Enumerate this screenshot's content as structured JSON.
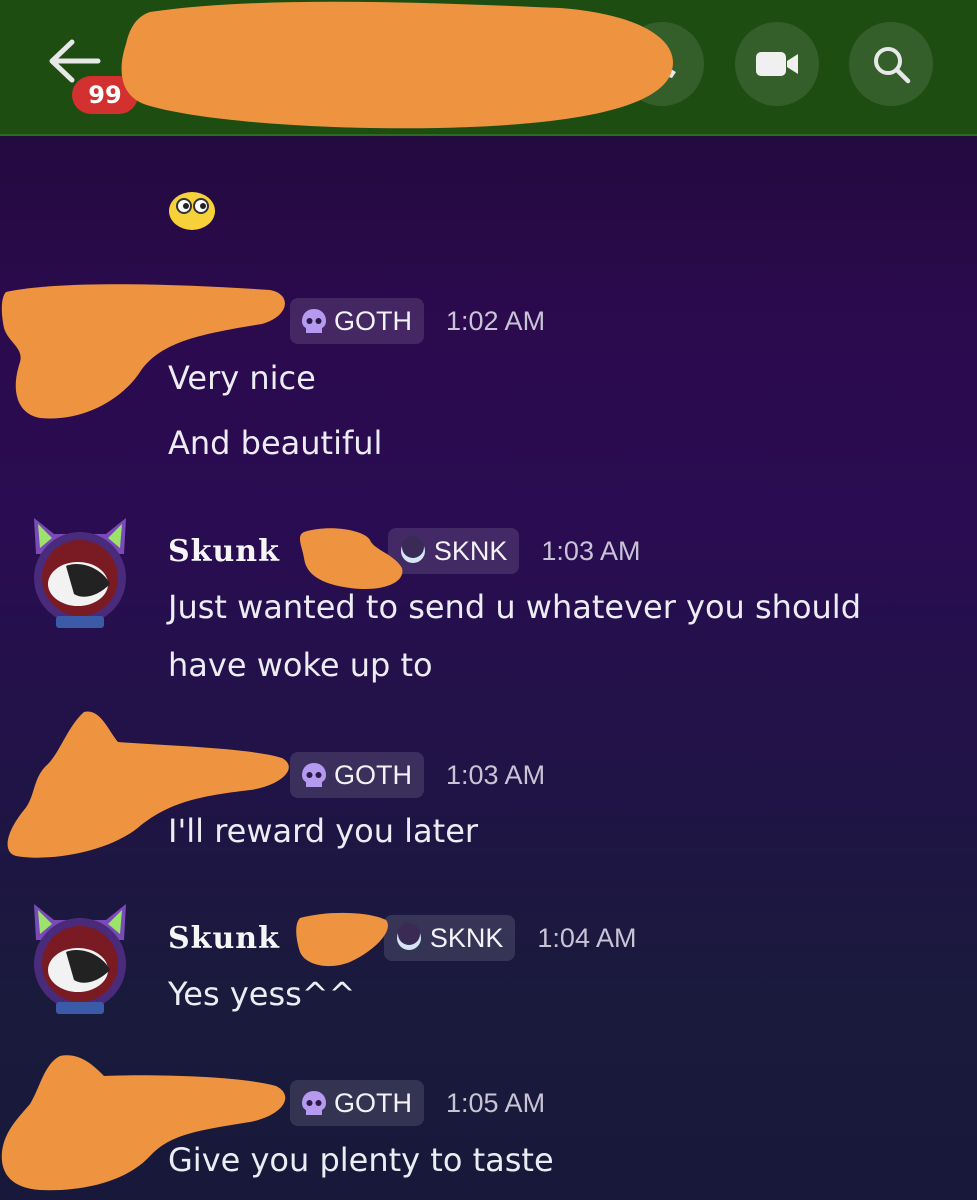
{
  "header": {
    "unread_badge": "99",
    "icons": [
      "back-arrow-icon",
      "call-icon",
      "video-icon",
      "search-icon"
    ]
  },
  "emoji_message": {
    "icon": "eyes-emoji"
  },
  "messages": [
    {
      "author": "",
      "tag": "GOTH",
      "tag_icon": "skull-icon",
      "time": "1:02 AM",
      "lines": [
        "Very nice",
        "And beautiful"
      ]
    },
    {
      "author": "Skunk",
      "tag": "SKNK",
      "tag_icon": "crescent-icon",
      "time": "1:03 AM",
      "lines": [
        "Just wanted to send u whatever you should",
        "have woke up to"
      ]
    },
    {
      "author": "",
      "tag": "GOTH",
      "tag_icon": "skull-icon",
      "time": "1:03 AM",
      "lines": [
        "I'll reward you later"
      ]
    },
    {
      "author": "Skunk",
      "tag": "SKNK",
      "tag_icon": "crescent-icon",
      "time": "1:04 AM",
      "lines": [
        "Yes yess^^"
      ]
    },
    {
      "author": "",
      "tag": "GOTH",
      "tag_icon": "skull-icon",
      "time": "1:05 AM",
      "lines": [
        "Give you plenty to taste"
      ]
    }
  ],
  "colors": {
    "header_bg": "#1e4d12",
    "badge": "#d3312f",
    "redaction": "#ee9440",
    "background_top": "#2b0a4e",
    "background_bottom": "#18193a"
  }
}
